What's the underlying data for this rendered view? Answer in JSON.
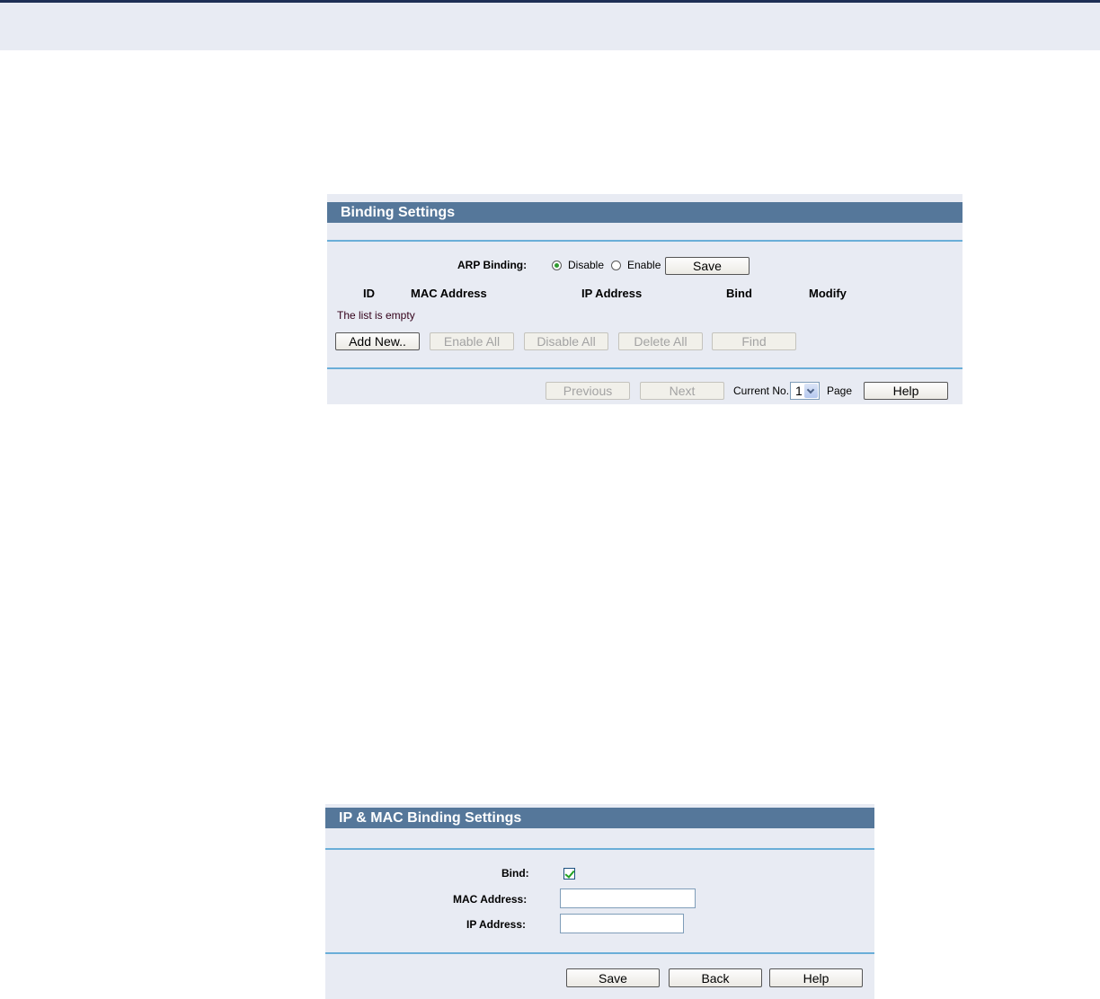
{
  "binding_panel": {
    "title": "Binding Settings",
    "arp_binding_label": "ARP Binding:",
    "disable_label": "Disable",
    "enable_label": "Enable",
    "selected": "Disable",
    "save_label": "Save",
    "columns": [
      "ID",
      "MAC Address",
      "IP Address",
      "Bind",
      "Modify"
    ],
    "empty_message": "The list is empty",
    "actions": {
      "add_new": "Add New..",
      "enable_all": "Enable All",
      "disable_all": "Disable All",
      "delete_all": "Delete All",
      "find": "Find"
    },
    "pager": {
      "previous": "Previous",
      "next": "Next",
      "current_no_label": "Current No.",
      "current_value": "1",
      "page_label": "Page",
      "help": "Help"
    }
  },
  "ipmac_panel": {
    "title": "IP & MAC Binding Settings",
    "bind_label": "Bind:",
    "bind_checked": true,
    "mac_label": "MAC Address:",
    "mac_value": "",
    "ip_label": "IP Address:",
    "ip_value": "",
    "save_label": "Save",
    "back_label": "Back",
    "help_label": "Help"
  }
}
